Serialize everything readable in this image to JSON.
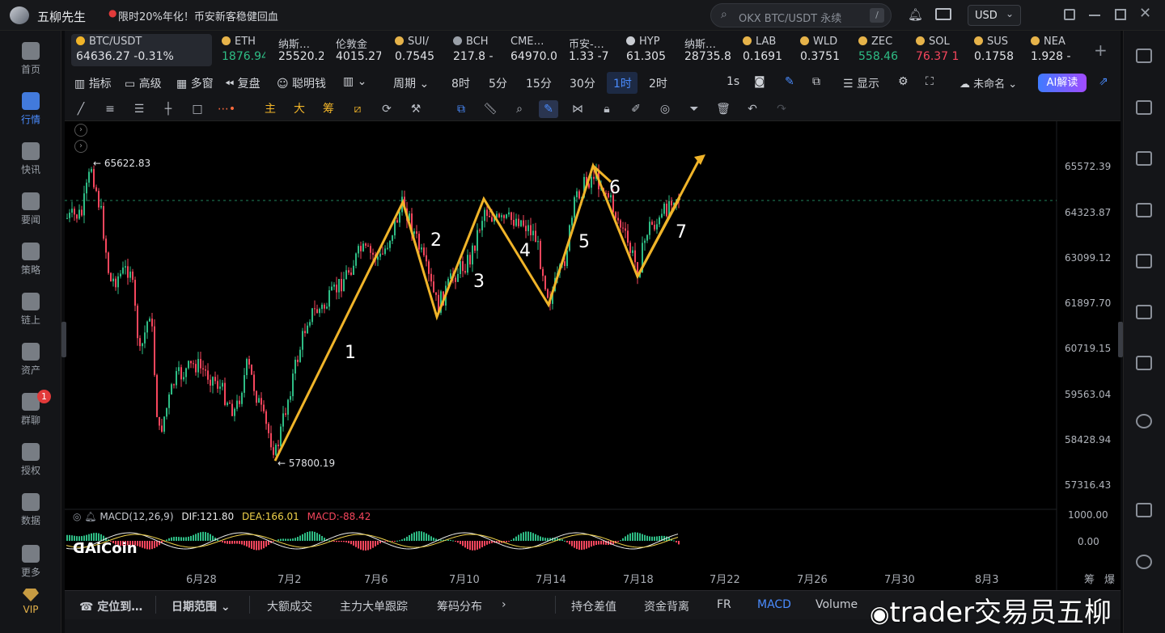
{
  "app": {
    "title": "五柳先生",
    "promo": "限时20%年化！币安新客稳健回血",
    "search_placeholder": "OKX BTC/USDT 永续",
    "search_shortcut": "/",
    "currency": "USD"
  },
  "leftnav": [
    {
      "label": "首页",
      "icon": "home-icon"
    },
    {
      "label": "行情",
      "icon": "chart-bars-icon",
      "active": true
    },
    {
      "label": "快讯",
      "icon": "news-icon"
    },
    {
      "label": "要闻",
      "icon": "document-icon"
    },
    {
      "label": "策略",
      "icon": "robot-icon"
    },
    {
      "label": "链上",
      "icon": "chain-icon"
    },
    {
      "label": "资产",
      "icon": "wallet-icon"
    },
    {
      "label": "群聊",
      "icon": "chat-icon",
      "badge": "1"
    },
    {
      "label": "授权",
      "icon": "key-icon"
    },
    {
      "label": "数据",
      "icon": "data-icon"
    },
    {
      "label": "更多",
      "icon": "grid-icon"
    },
    {
      "label": "VIP",
      "icon": "vip-diamond-icon"
    }
  ],
  "tickers": [
    {
      "name": "BTC/USDT",
      "price": "64636.27",
      "change": "-0.31%"
    },
    {
      "name": "ETH",
      "price": "1876.94"
    },
    {
      "name": "纳斯…",
      "price": "25520.2"
    },
    {
      "name": "伦敦金",
      "price": "4015.27"
    },
    {
      "name": "SUI/",
      "price": "0.7545"
    },
    {
      "name": "BCH",
      "price": "217.8 -"
    },
    {
      "name": "CME…",
      "price": "64970.0"
    },
    {
      "name": "币安-…",
      "price": "1.33 -7"
    },
    {
      "name": "HYP",
      "price": "61.305"
    },
    {
      "name": "纳斯…",
      "price": "28735.8"
    },
    {
      "name": "LAB",
      "price": "0.1691"
    },
    {
      "name": "WLD",
      "price": "0.3751"
    },
    {
      "name": "ZEC",
      "price": "558.46"
    },
    {
      "name": "SOL",
      "price": "76.37 1"
    },
    {
      "name": "SUS",
      "price": "0.1758"
    },
    {
      "name": "NEA",
      "price": "1.928 -"
    }
  ],
  "toolbar": {
    "indicators": "指标",
    "advanced": "高级",
    "multi_window": "多窗",
    "replay": "复盘",
    "smart_money": "聪明钱",
    "period": "周期",
    "intervals": [
      "8时",
      "5分",
      "15分",
      "30分",
      "1时",
      "2时"
    ],
    "active_interval": "1时",
    "tick": "1s",
    "display": "显示",
    "layout_name": "未命名",
    "ai_button": "AI解读"
  },
  "drawtools": {
    "main": "主",
    "big": "大",
    "chips": "筹"
  },
  "chart": {
    "high_label": "← 65622.83",
    "low_label": "← 57800.19",
    "price_axis": [
      "65572.39",
      "64323.87",
      "63099.12",
      "61897.70",
      "60719.15",
      "59563.04",
      "58428.94",
      "57316.43"
    ],
    "macd_axis": [
      "1000.00",
      "0.00"
    ],
    "date_axis": [
      "6月28",
      "7月2",
      "7月6",
      "7月10",
      "7月14",
      "7月18",
      "7月22",
      "7月26",
      "7月30",
      "8月3"
    ],
    "wave_labels": [
      "1",
      "2",
      "3",
      "4",
      "5",
      "6",
      "7"
    ],
    "macd": {
      "name": "MACD(12,26,9)",
      "dif": "DIF:121.80",
      "dea": "DEA:166.01",
      "macd": "MACD:-88.42"
    },
    "watermark": "AiCoin",
    "colors": {
      "up": "#2ebd85",
      "down": "#f6465d",
      "wave": "#f0b429",
      "dif": "#e9e9e9",
      "dea": "#f0d24a"
    }
  },
  "bottombar": {
    "locate": "定位到…",
    "date_range": "日期范围",
    "tabs": [
      "大额成交",
      "主力大单跟踪",
      "筹码分布"
    ],
    "indicators": [
      "持仓差值",
      "资金背离",
      "FR",
      "MACD",
      "Volume"
    ],
    "active_indicator": "MACD",
    "right_labels": [
      "筹",
      "爆"
    ]
  },
  "watermark_text": "trader交易员五柳"
}
